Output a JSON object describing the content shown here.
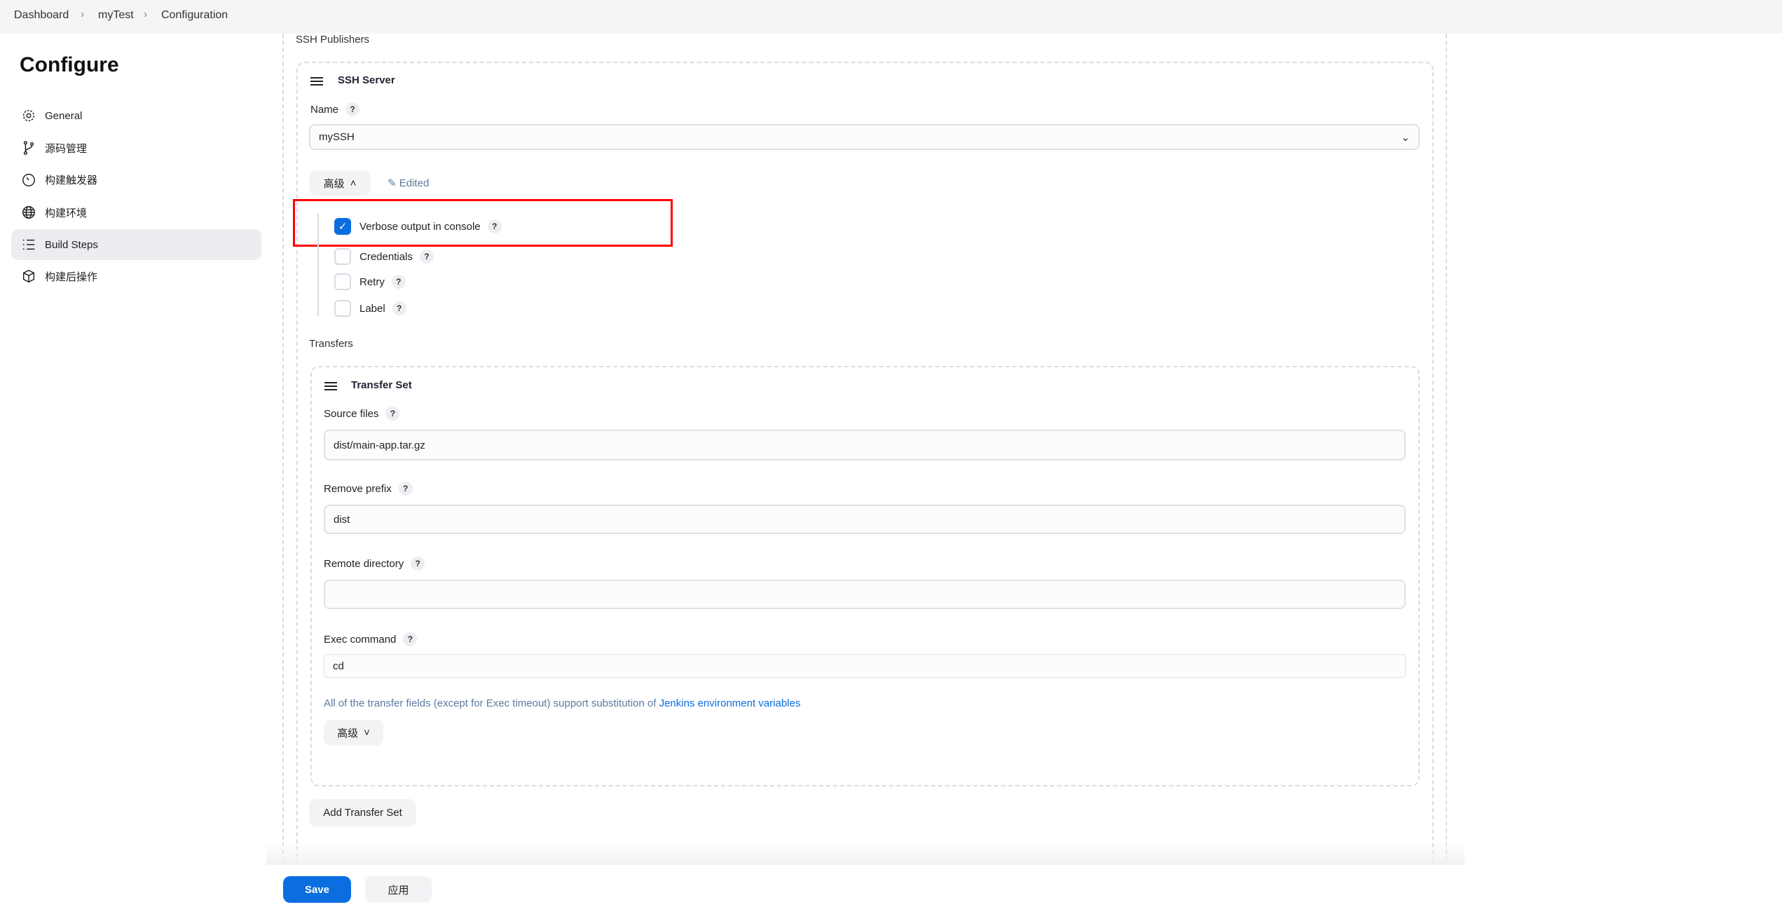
{
  "breadcrumb": [
    "Dashboard",
    "myTest",
    "Configuration"
  ],
  "sidebar": {
    "title": "Configure",
    "items": [
      {
        "label": "General",
        "icon": "gear-icon"
      },
      {
        "label": "源码管理",
        "icon": "branch-icon"
      },
      {
        "label": "构建触发器",
        "icon": "timer-icon"
      },
      {
        "label": "构建环境",
        "icon": "globe-icon"
      },
      {
        "label": "Build Steps",
        "icon": "list-icon",
        "active": true
      },
      {
        "label": "构建后操作",
        "icon": "package-icon"
      }
    ]
  },
  "main": {
    "section_label": "SSH Publishers",
    "server": {
      "title": "SSH Server",
      "name_label": "Name",
      "name_value": "mySSH",
      "advanced_label": "高级",
      "edited_label": "Edited",
      "options": [
        {
          "label": "Verbose output in console",
          "checked": true
        },
        {
          "label": "Credentials",
          "checked": false
        },
        {
          "label": "Retry",
          "checked": false
        },
        {
          "label": "Label",
          "checked": false
        }
      ]
    },
    "transfers_label": "Transfers",
    "transfer_set": {
      "title": "Transfer Set",
      "source_files_label": "Source files",
      "source_files": "dist/main-app.tar.gz",
      "remove_prefix_label": "Remove prefix",
      "remove_prefix": "dist",
      "remote_directory_label": "Remote directory",
      "remote_directory": "",
      "exec_command_label": "Exec command",
      "exec_command": "cd",
      "help_text": "All of the transfer fields (except for Exec timeout) support substitution of ",
      "help_link": "Jenkins environment variables",
      "advanced_label": "高级"
    },
    "add_transfer_set": "Add Transfer Set"
  },
  "footer": {
    "save": "Save",
    "apply": "应用"
  },
  "help_glyph": "?",
  "colors": {
    "accent": "#0b6ee0",
    "highlight": "#ff0000"
  }
}
